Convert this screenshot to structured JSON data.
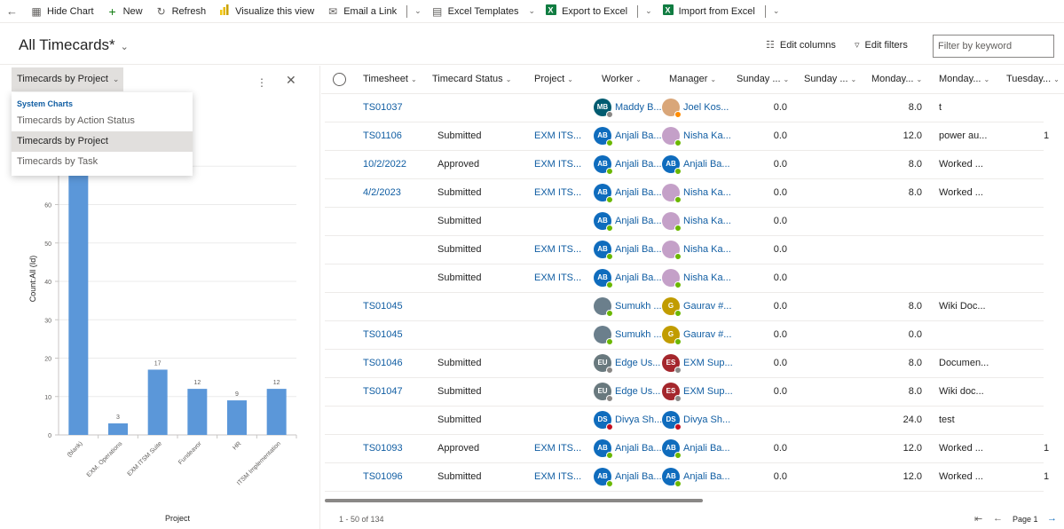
{
  "toolbar": {
    "back_label": "←",
    "hide_chart": "Hide Chart",
    "new": "New",
    "refresh": "Refresh",
    "visualize": "Visualize this view",
    "email_link": "Email a Link",
    "excel_templates": "Excel Templates",
    "export_excel": "Export to Excel",
    "import_excel": "Import from Excel"
  },
  "header": {
    "view_title": "All Timecards*",
    "edit_columns": "Edit columns",
    "edit_filters": "Edit filters",
    "filter_placeholder": "Filter by keyword"
  },
  "chart_panel": {
    "selected_chart": "Timecards by Project",
    "menu_header": "System Charts",
    "menu_items": [
      "Timecards by Action Status",
      "Timecards by Project",
      "Timecards by Task"
    ]
  },
  "chart_data": {
    "type": "bar",
    "categories": [
      "(blank)",
      "EXM. Operations",
      "EXM ITSM Suite",
      "Fundeavor",
      "HR",
      "ITSM Implementation"
    ],
    "values": [
      77,
      3,
      17,
      12,
      9,
      12
    ],
    "data_labels": [
      "",
      "3",
      "17",
      "12",
      "9",
      "12"
    ],
    "xlabel": "Project",
    "ylabel": "Count:All (Id)",
    "yticks": [
      0,
      10,
      20,
      30,
      40,
      50,
      60,
      70
    ],
    "ylim": [
      0,
      80
    ],
    "color": "#5b97d9",
    "grid": true
  },
  "grid": {
    "columns": [
      "Timesheet",
      "Timecard Status",
      "Project",
      "Worker",
      "Manager",
      "Sunday ...",
      "Sunday ...",
      "Monday...",
      "Monday...",
      "Tuesday..."
    ],
    "rows": [
      {
        "timesheet": "TS01037",
        "status": "",
        "project": "",
        "worker": {
          "name": "Maddy B...",
          "initials": "MB",
          "color": "#005b70",
          "presence": "#8a8886"
        },
        "manager": {
          "name": "Joel Kos...",
          "initials": "",
          "color": "#d9a679",
          "presence": "#ff8c00"
        },
        "sun": "0.0",
        "mon": "8.0",
        "desc": "t",
        "tail": ""
      },
      {
        "timesheet": "TS01106",
        "status": "Submitted",
        "project": "EXM ITS...",
        "worker": {
          "name": "Anjali Ba...",
          "initials": "AB",
          "color": "#0f6cbd",
          "presence": "#6bb700"
        },
        "manager": {
          "name": "Nisha Ka...",
          "initials": "",
          "color": "#c4a0c8",
          "presence": "#6bb700"
        },
        "sun": "0.0",
        "mon": "12.0",
        "desc": "power au...",
        "tail": "1"
      },
      {
        "timesheet": "10/2/2022",
        "status": "Approved",
        "project": "EXM ITS...",
        "worker": {
          "name": "Anjali Ba...",
          "initials": "AB",
          "color": "#0f6cbd",
          "presence": "#6bb700"
        },
        "manager": {
          "name": "Anjali Ba...",
          "initials": "AB",
          "color": "#0f6cbd",
          "presence": "#6bb700"
        },
        "sun": "0.0",
        "mon": "8.0",
        "desc": "Worked ...",
        "tail": ""
      },
      {
        "timesheet": "4/2/2023",
        "status": "Submitted",
        "project": "EXM ITS...",
        "worker": {
          "name": "Anjali Ba...",
          "initials": "AB",
          "color": "#0f6cbd",
          "presence": "#6bb700"
        },
        "manager": {
          "name": "Nisha Ka...",
          "initials": "",
          "color": "#c4a0c8",
          "presence": "#6bb700"
        },
        "sun": "0.0",
        "mon": "8.0",
        "desc": "Worked ...",
        "tail": ""
      },
      {
        "timesheet": "",
        "status": "Submitted",
        "project": "",
        "worker": {
          "name": "Anjali Ba...",
          "initials": "AB",
          "color": "#0f6cbd",
          "presence": "#6bb700"
        },
        "manager": {
          "name": "Nisha Ka...",
          "initials": "",
          "color": "#c4a0c8",
          "presence": "#6bb700"
        },
        "sun": "0.0",
        "mon": "",
        "desc": "",
        "tail": ""
      },
      {
        "timesheet": "",
        "status": "Submitted",
        "project": "EXM ITS...",
        "worker": {
          "name": "Anjali Ba...",
          "initials": "AB",
          "color": "#0f6cbd",
          "presence": "#6bb700"
        },
        "manager": {
          "name": "Nisha Ka...",
          "initials": "",
          "color": "#c4a0c8",
          "presence": "#6bb700"
        },
        "sun": "0.0",
        "mon": "",
        "desc": "",
        "tail": ""
      },
      {
        "timesheet": "",
        "status": "Submitted",
        "project": "EXM ITS...",
        "worker": {
          "name": "Anjali Ba...",
          "initials": "AB",
          "color": "#0f6cbd",
          "presence": "#6bb700"
        },
        "manager": {
          "name": "Nisha Ka...",
          "initials": "",
          "color": "#c4a0c8",
          "presence": "#6bb700"
        },
        "sun": "0.0",
        "mon": "",
        "desc": "",
        "tail": ""
      },
      {
        "timesheet": "TS01045",
        "status": "",
        "project": "",
        "worker": {
          "name": "Sumukh ...",
          "initials": "",
          "color": "#6b7f8c",
          "presence": "#6bb700"
        },
        "manager": {
          "name": "Gaurav #...",
          "initials": "G",
          "color": "#c19c00",
          "presence": "#6bb700"
        },
        "sun": "0.0",
        "mon": "8.0",
        "desc": "Wiki Doc...",
        "tail": ""
      },
      {
        "timesheet": "TS01045",
        "status": "",
        "project": "",
        "worker": {
          "name": "Sumukh ...",
          "initials": "",
          "color": "#6b7f8c",
          "presence": "#6bb700"
        },
        "manager": {
          "name": "Gaurav #...",
          "initials": "G",
          "color": "#c19c00",
          "presence": "#6bb700"
        },
        "sun": "0.0",
        "mon": "0.0",
        "desc": "",
        "tail": ""
      },
      {
        "timesheet": "TS01046",
        "status": "Submitted",
        "project": "",
        "worker": {
          "name": "Edge Us...",
          "initials": "EU",
          "color": "#69797e",
          "presence": "#8a8886"
        },
        "manager": {
          "name": "EXM Sup...",
          "initials": "ES",
          "color": "#a4262c",
          "presence": "#8a8886"
        },
        "sun": "0.0",
        "mon": "8.0",
        "desc": "Documen...",
        "tail": ""
      },
      {
        "timesheet": "TS01047",
        "status": "Submitted",
        "project": "",
        "worker": {
          "name": "Edge Us...",
          "initials": "EU",
          "color": "#69797e",
          "presence": "#8a8886"
        },
        "manager": {
          "name": "EXM Sup...",
          "initials": "ES",
          "color": "#a4262c",
          "presence": "#8a8886"
        },
        "sun": "0.0",
        "mon": "8.0",
        "desc": "Wiki doc...",
        "tail": ""
      },
      {
        "timesheet": "",
        "status": "Submitted",
        "project": "",
        "worker": {
          "name": "Divya Sh...",
          "initials": "DS",
          "color": "#0f6cbd",
          "presence": "#c50f1f"
        },
        "manager": {
          "name": "Divya Sh...",
          "initials": "DS",
          "color": "#0f6cbd",
          "presence": "#c50f1f"
        },
        "sun": "",
        "mon": "24.0",
        "desc": "test",
        "tail": ""
      },
      {
        "timesheet": "TS01093",
        "status": "Approved",
        "project": "EXM ITS...",
        "worker": {
          "name": "Anjali Ba...",
          "initials": "AB",
          "color": "#0f6cbd",
          "presence": "#6bb700"
        },
        "manager": {
          "name": "Anjali Ba...",
          "initials": "AB",
          "color": "#0f6cbd",
          "presence": "#6bb700"
        },
        "sun": "0.0",
        "mon": "12.0",
        "desc": "Worked ...",
        "tail": "1"
      },
      {
        "timesheet": "TS01096",
        "status": "Submitted",
        "project": "EXM ITS...",
        "worker": {
          "name": "Anjali Ba...",
          "initials": "AB",
          "color": "#0f6cbd",
          "presence": "#6bb700"
        },
        "manager": {
          "name": "Anjali Ba...",
          "initials": "AB",
          "color": "#0f6cbd",
          "presence": "#6bb700"
        },
        "sun": "0.0",
        "mon": "12.0",
        "desc": "Worked ...",
        "tail": "1"
      }
    ]
  },
  "footer": {
    "record_count": "1 - 50 of 134",
    "page_label": "Page 1"
  }
}
